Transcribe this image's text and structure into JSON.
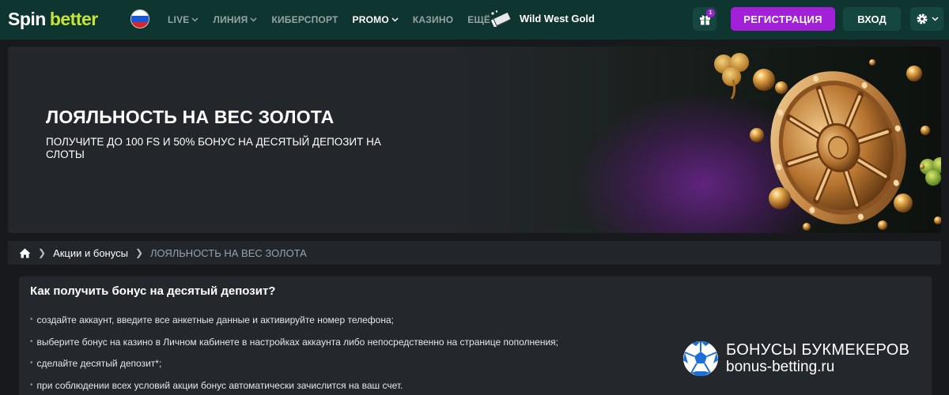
{
  "header": {
    "logo": {
      "part1": "Spin",
      "part2": "better"
    },
    "nav": [
      {
        "label": "LIVE",
        "chevron": true
      },
      {
        "label": "ЛИНИЯ",
        "chevron": true
      },
      {
        "label": "КИБЕРСПОРТ",
        "chevron": false
      },
      {
        "label": "PROMO",
        "chevron": true
      },
      {
        "label": "КАЗИНО",
        "chevron": false
      },
      {
        "label": "ЕЩЁ",
        "chevron": true
      }
    ],
    "promo_game": "Wild West Gold",
    "gift_count": "1",
    "register_label": "РЕГИСТРАЦИЯ",
    "login_label": "ВХОД"
  },
  "banner": {
    "title": "ЛОЯЛЬНОСТЬ НА ВЕС ЗОЛОТА",
    "subtitle": "ПОЛУЧИТЕ ДО 100 FS И 50% БОНУС НА ДЕСЯТЫЙ ДЕПОЗИТ НА СЛОТЫ"
  },
  "breadcrumb": {
    "link": "Акции и бонусы",
    "current": "ЛОЯЛЬНОСТЬ НА ВЕС ЗОЛОТА"
  },
  "content": {
    "title": "Как получить бонус на десятый депозит?",
    "steps": [
      "создайте аккаунт, введите все анкетные данные и активируйте номер телефона;",
      "выберите бонус на казино в Личном кабинете в настройках аккаунта либо непосредственно на странице пополнения;",
      "сделайте десятый депозит*;",
      "при соблюдении всех условий акции бонус автоматически зачислится на ваш счет."
    ]
  },
  "watermark": {
    "line1": "БОНУСЫ БУКМЕКЕРОВ",
    "line2": "bonus-betting.ru"
  },
  "colors": {
    "header_bg": "#0e3530",
    "brand_green": "#c6e33a",
    "register_purple": "#a220d8",
    "button_dark_green": "#164640"
  }
}
